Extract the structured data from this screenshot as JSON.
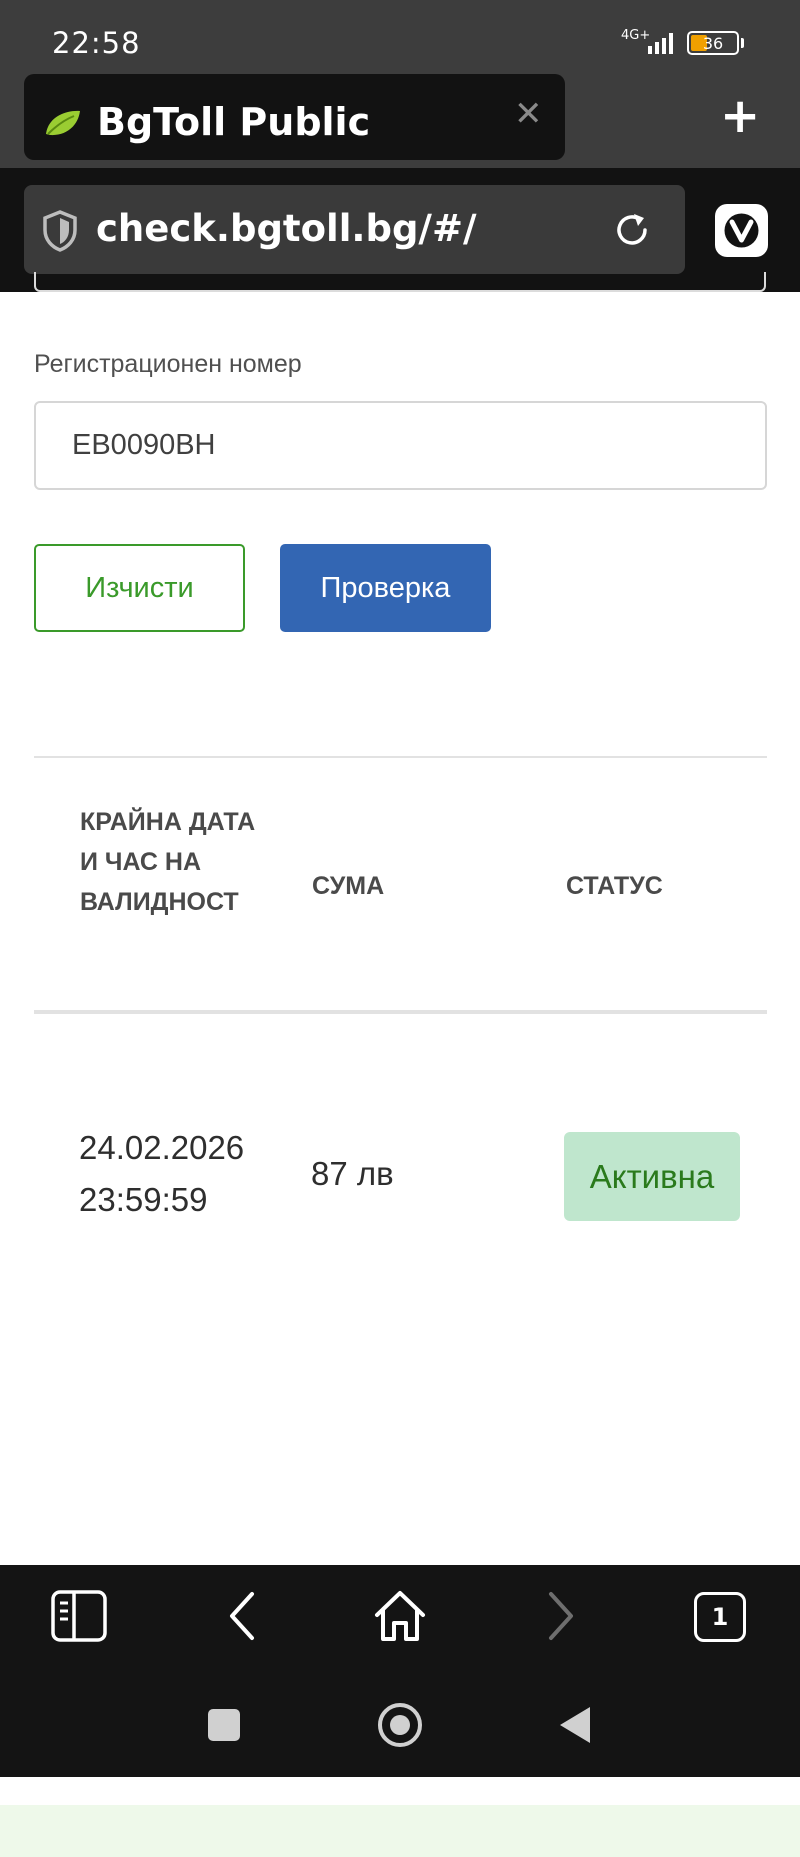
{
  "status_bar": {
    "time": "22:58",
    "network": "4G+",
    "battery": "36",
    "battery_level": 0.36
  },
  "browser": {
    "tab": {
      "title": "BgToll Public",
      "close_icon": "close-icon",
      "favicon": "leaf-icon"
    },
    "new_tab_icon": "plus-icon",
    "url": "check.bgtoll.bg/#/",
    "security_icon": "shield-icon",
    "reload_icon": "reload-icon",
    "menu_icon": "vivaldi-icon"
  },
  "form": {
    "plate_label": "Регистрационен номер",
    "plate_value": "EB0090BH",
    "clear_label": "Изчисти",
    "check_label": "Проверка"
  },
  "table": {
    "headers": {
      "date": "КРАЙНА ДАТА И ЧАС НА ВАЛИДНОСТ",
      "amount": "СУМА",
      "status": "СТАТУС"
    },
    "rows": [
      {
        "date": "24.02.2026",
        "time": "23:59:59",
        "amount": "87 лв",
        "status": "Активна"
      }
    ]
  },
  "colors": {
    "clear_button": "#3a9a2a",
    "check_button": "#3366b3",
    "status_active_bg": "#bfe6cd",
    "status_active_text": "#2a7a1c"
  },
  "toolbar": {
    "panel_icon": "panel-icon",
    "back_icon": "chevron-left-icon",
    "home_icon": "home-icon",
    "forward_icon": "chevron-right-icon",
    "tab_count": "1"
  },
  "system_nav": {
    "recents_icon": "square-icon",
    "home_icon": "circle-icon",
    "back_icon": "triangle-back-icon"
  }
}
